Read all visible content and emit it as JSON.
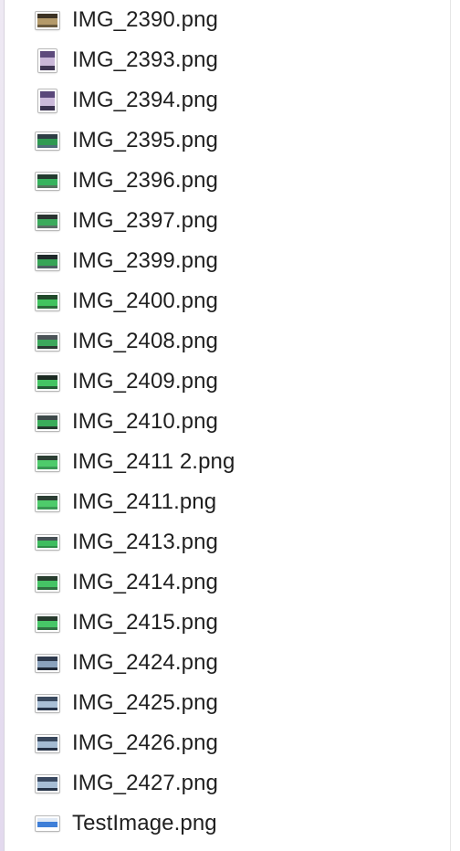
{
  "files": [
    {
      "name": "IMG_2390.png",
      "icon": "image-thumbnail-icon",
      "shape": "landscape",
      "colors": [
        "#3d3324",
        "#b49a6a",
        "#6a5a3e"
      ]
    },
    {
      "name": "IMG_2393.png",
      "icon": "image-thumbnail-icon",
      "shape": "portrait",
      "colors": [
        "#5d4a7c",
        "#c9b7d8",
        "#3f3654"
      ]
    },
    {
      "name": "IMG_2394.png",
      "icon": "image-thumbnail-icon",
      "shape": "portrait",
      "colors": [
        "#5a477a",
        "#cbb9da",
        "#3b3250"
      ]
    },
    {
      "name": "IMG_2395.png",
      "icon": "image-thumbnail-icon",
      "shape": "landscape",
      "colors": [
        "#2d3d44",
        "#2f9a52",
        "#4f6d7a"
      ]
    },
    {
      "name": "IMG_2396.png",
      "icon": "image-thumbnail-icon",
      "shape": "landscape",
      "colors": [
        "#233b2f",
        "#36b35d",
        "#56735f"
      ]
    },
    {
      "name": "IMG_2397.png",
      "icon": "image-thumbnail-icon",
      "shape": "landscape",
      "colors": [
        "#2a3431",
        "#3bab5c",
        "#5b6e66"
      ]
    },
    {
      "name": "IMG_2399.png",
      "icon": "image-thumbnail-icon",
      "shape": "landscape",
      "colors": [
        "#1f2a2a",
        "#37a557",
        "#4e5f62"
      ]
    },
    {
      "name": "IMG_2400.png",
      "icon": "image-thumbnail-icon",
      "shape": "landscape",
      "colors": [
        "#214a2b",
        "#41c35f",
        "#2b6a3a"
      ]
    },
    {
      "name": "IMG_2408.png",
      "icon": "image-thumbnail-icon",
      "shape": "landscape",
      "colors": [
        "#4c5458",
        "#3ca85c",
        "#2b3a33"
      ]
    },
    {
      "name": "IMG_2409.png",
      "icon": "image-thumbnail-icon",
      "shape": "landscape",
      "colors": [
        "#1c2a22",
        "#44c463",
        "#245a35"
      ]
    },
    {
      "name": "IMG_2410.png",
      "icon": "image-thumbnail-icon",
      "shape": "landscape",
      "colors": [
        "#3e4a4a",
        "#3aad5a",
        "#263a2f"
      ]
    },
    {
      "name": "IMG_2411 2.png",
      "icon": "image-thumbnail-icon",
      "shape": "landscape",
      "colors": [
        "#2c3f34",
        "#4ecb6b",
        "#3a9a55"
      ]
    },
    {
      "name": "IMG_2411.png",
      "icon": "image-thumbnail-icon",
      "shape": "landscape",
      "colors": [
        "#2c3f34",
        "#4ecb6b",
        "#3a9a55"
      ]
    },
    {
      "name": "IMG_2413.png",
      "icon": "image-thumbnail-icon",
      "shape": "wide",
      "colors": [
        "#465055",
        "#3fbd5f",
        "#2f8c48"
      ]
    },
    {
      "name": "IMG_2414.png",
      "icon": "image-thumbnail-icon",
      "shape": "landscape",
      "colors": [
        "#273d2e",
        "#45c365",
        "#2f6e40"
      ]
    },
    {
      "name": "IMG_2415.png",
      "icon": "image-thumbnail-icon",
      "shape": "landscape",
      "colors": [
        "#26392c",
        "#47c667",
        "#306f42"
      ]
    },
    {
      "name": "IMG_2424.png",
      "icon": "image-thumbnail-icon",
      "shape": "landscape",
      "colors": [
        "#2e3a4e",
        "#8aa2bd",
        "#1f2836"
      ]
    },
    {
      "name": "IMG_2425.png",
      "icon": "image-thumbnail-icon",
      "shape": "landscape",
      "colors": [
        "#3a4a60",
        "#a9bfd6",
        "#27344a"
      ]
    },
    {
      "name": "IMG_2426.png",
      "icon": "image-thumbnail-icon",
      "shape": "landscape",
      "colors": [
        "#38475c",
        "#a4bbd3",
        "#253145"
      ]
    },
    {
      "name": "IMG_2427.png",
      "icon": "image-thumbnail-icon",
      "shape": "landscape",
      "colors": [
        "#394860",
        "#a6bdd5",
        "#263347"
      ]
    },
    {
      "name": "TestImage.png",
      "icon": "image-thumbnail-icon",
      "shape": "wide",
      "colors": [
        "#dfe9f5",
        "#3f7fd8",
        "#ffffff"
      ]
    }
  ]
}
